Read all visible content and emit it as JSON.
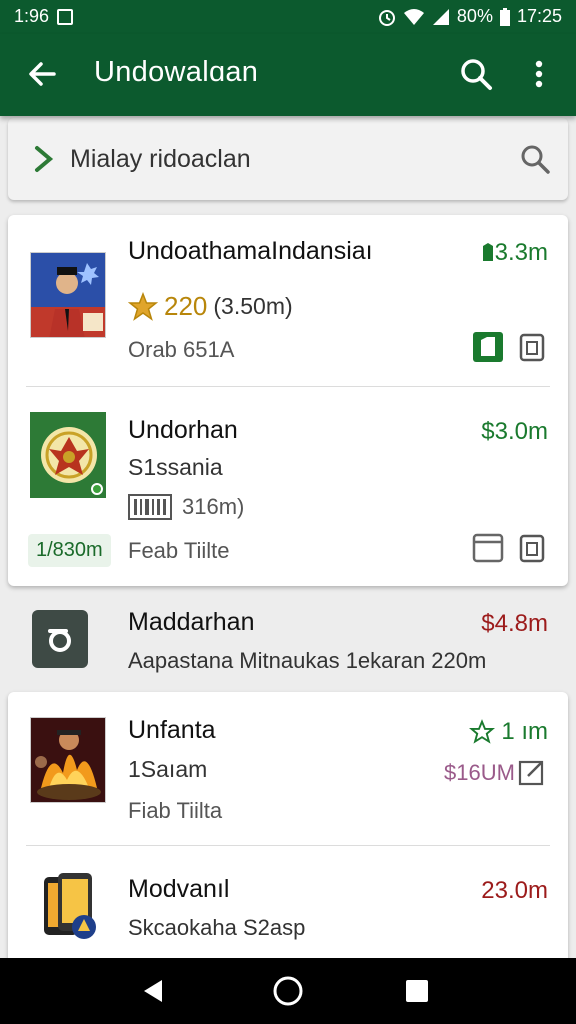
{
  "status": {
    "time_left": "1:96",
    "battery_pct": "80%",
    "clock": "17:25"
  },
  "appbar": {
    "title": "Undowalɑan"
  },
  "filter": {
    "text": "Mialay ridoaclan"
  },
  "items": [
    {
      "name": "UndoathamaIndansiaı",
      "rating": "220",
      "rating_detail": "(3.50m)",
      "detail": "Orab 651A",
      "price": "3.3m"
    },
    {
      "name": "Undorhan",
      "subtitle": "S1ssania",
      "meta": "316m)",
      "chip": "1/830m",
      "detail": "Feab Tiilte",
      "price": "$3.0m"
    },
    {
      "name": "Maddarhan",
      "detail": "Aapastana Mitnaukas 1ekaran 220m",
      "price": "$4.8m"
    },
    {
      "name": "Unfanta",
      "subtitle": "1Saıam",
      "price_top": "1 ım",
      "price": "$16UM",
      "detail": "Fiab Tiilta"
    },
    {
      "name": "Modvanıl",
      "detail": "Skcaokaha S2asp",
      "price": "23.0m"
    }
  ],
  "colors": {
    "appbar": "#0c5a2e",
    "accent_green": "#1a7a2e",
    "price_red": "#9c1b1b"
  }
}
